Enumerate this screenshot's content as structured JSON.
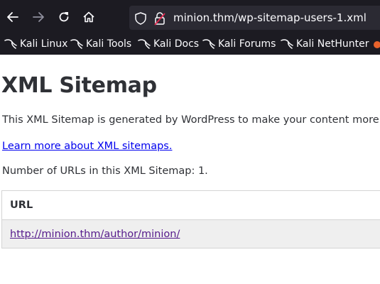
{
  "browser": {
    "url": "minion.thm/wp-sitemap-users-1.xml",
    "bookmarks": [
      {
        "label": "Kali Linux"
      },
      {
        "label": "Kali Tools"
      },
      {
        "label": "Kali Docs"
      },
      {
        "label": "Kali Forums"
      },
      {
        "label": "Kali NetHunter"
      }
    ],
    "colors": {
      "chrome": "#1c1b22",
      "urlbar": "#2b2a33",
      "overflow_icon": "#e8632c"
    },
    "icons": [
      "back-arrow-icon",
      "forward-arrow-icon",
      "reload-icon",
      "home-icon",
      "shield-icon",
      "lock-icon",
      "kali-dragon-icon"
    ]
  },
  "page": {
    "title": "XML Sitemap",
    "description": "This XML Sitemap is generated by WordPress to make your content more vis",
    "learn_more_link": "Learn more about XML sitemaps.",
    "url_count_text": "Number of URLs in this XML Sitemap: 1.",
    "table": {
      "header": "URL",
      "rows": [
        {
          "url": "http://minion.thm/author/minion/"
        }
      ]
    }
  }
}
